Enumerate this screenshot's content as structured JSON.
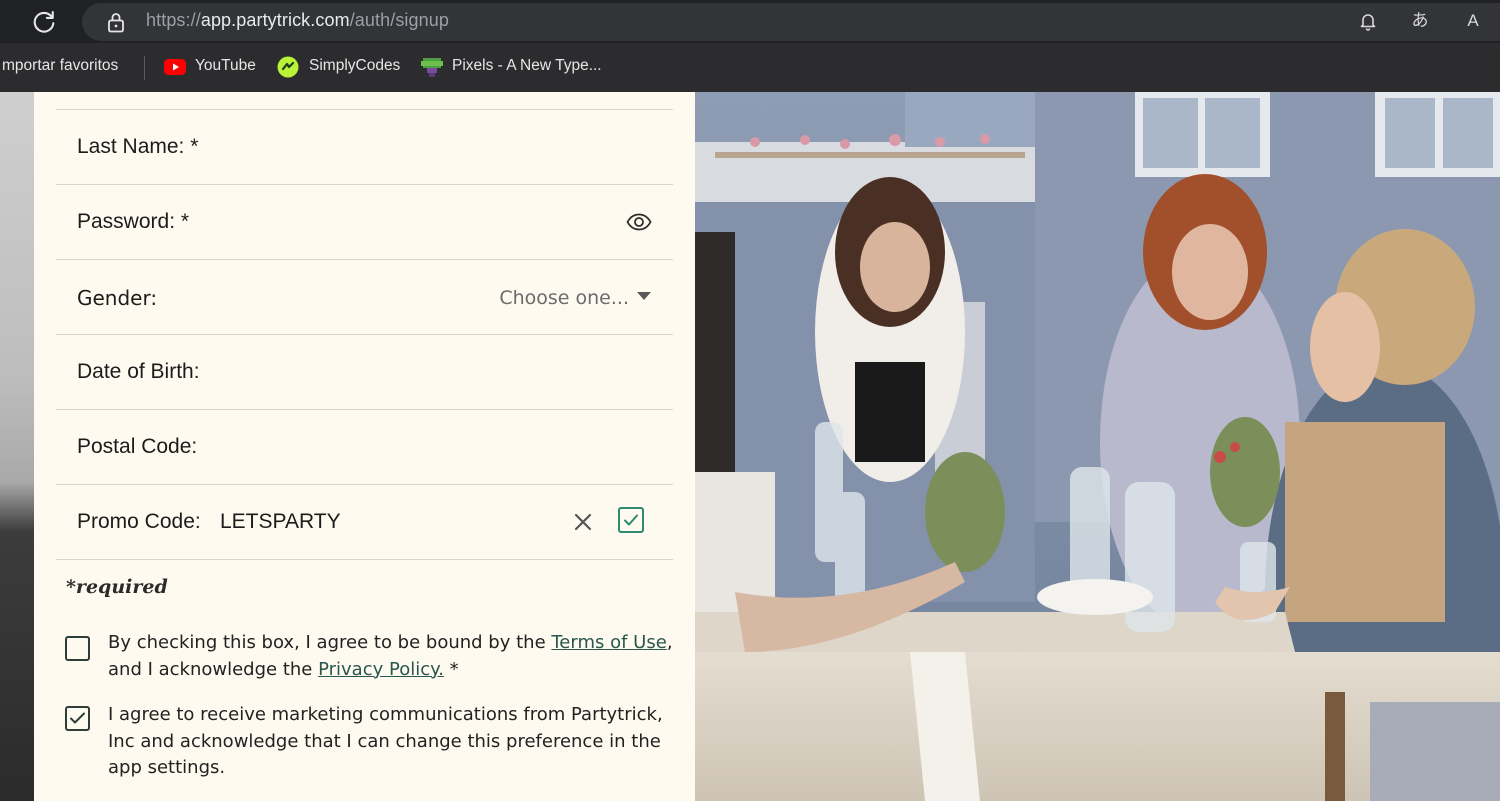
{
  "browser": {
    "url_prefix": "https://",
    "url_host": "app.partytrick.com",
    "url_path": "/auth/signup",
    "bookmarks": [
      {
        "label": "mportar favoritos"
      },
      {
        "label": "YouTube"
      },
      {
        "label": "SimplyCodes"
      },
      {
        "label": "Pixels - A New Type..."
      }
    ],
    "icons": [
      "reload-icon",
      "lock-icon",
      "bell-icon",
      "translate-icon",
      "read-aloud-icon"
    ],
    "translate_glyph": "あ",
    "read_aloud_glyph": "A"
  },
  "form": {
    "last_name_label": "Last Name: *",
    "password_label": "Password: *",
    "gender_label": "Gender:",
    "gender_placeholder": "Choose one...",
    "dob_label": "Date of Birth:",
    "postal_label": "Postal Code:",
    "promo_label": "Promo Code:",
    "promo_value": "LETSPARTY",
    "required_note": "*required",
    "terms_prefix": "By checking this box, I agree to be bound by the ",
    "terms_link": "Terms of Use",
    "terms_mid": ", and I acknowledge the ",
    "privacy_link": "Privacy Policy.",
    "terms_suffix": " *",
    "terms_checked": false,
    "marketing_text": "I agree to receive marketing communications from Partytrick, Inc and acknowledge that I can change this preference in the app settings.",
    "marketing_checked": true
  },
  "colors": {
    "panel_bg": "#fffaf0",
    "accent_green": "#2f8a6f",
    "link": "#27574d"
  }
}
